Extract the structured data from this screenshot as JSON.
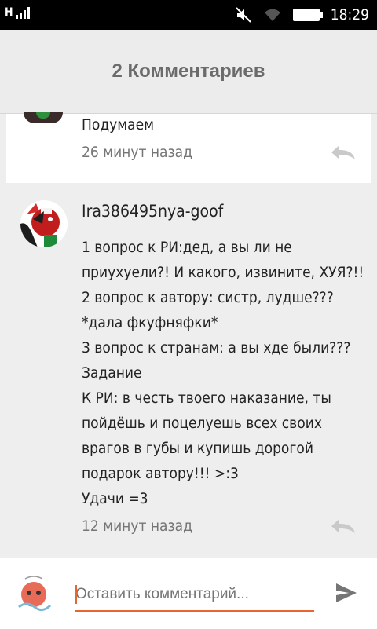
{
  "status": {
    "time": "18:29",
    "left_icons": "H ull"
  },
  "header": {
    "title": "2 Комментариев"
  },
  "comments": [
    {
      "text": "Подумаем",
      "time": "26 минут назад"
    },
    {
      "author": "Ira386495nya-goof",
      "lines": [
        "1 вопрос к РИ:дед, а вы ли не",
        "приухуели?! И какого, извините, ХУЯ?!!",
        "2 вопрос к автору: систр, лудше???",
        "*дала фкуфняфки*",
        "3 вопрос к странам: а вы хде были???",
        "Задание",
        "К РИ: в честь твоего наказание, ты",
        "пойдёшь и поцелуешь всех своих",
        "врагов в губы и купишь дорогой",
        "подарок автору!!! >:3",
        "Удачи =3"
      ],
      "time": "12 минут назад"
    }
  ],
  "composer": {
    "placeholder": "Оставить комментарий..."
  },
  "colors": {
    "accent": "#e8662e",
    "reply_icon": "#c9c9c9",
    "send_icon": "#757575"
  }
}
